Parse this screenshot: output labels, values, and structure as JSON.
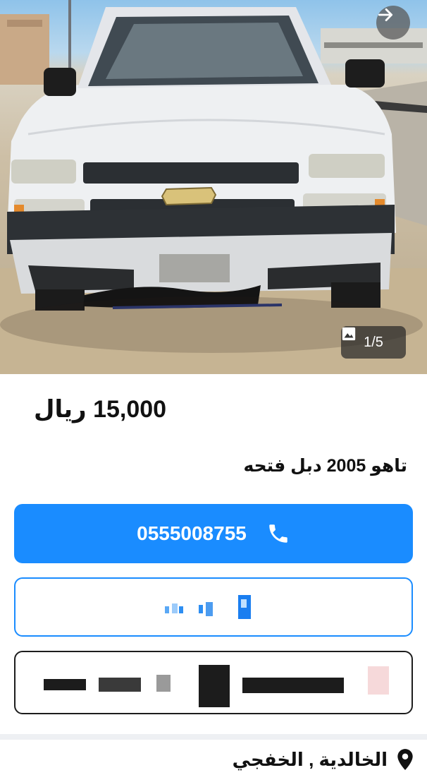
{
  "gallery": {
    "counter_text": "1/5",
    "current": 1,
    "total": 5
  },
  "listing": {
    "price_text": "15,000 ريال",
    "title": "تاهو 2005 دبل فتحه"
  },
  "actions": {
    "phone_number": "0555008755"
  },
  "location": {
    "text": "الخالدية , الخفجي"
  },
  "colors": {
    "accent": "#1a8cff",
    "text": "#111111",
    "divider": "#eef0f3"
  },
  "icons": {
    "next": "arrow-right-icon",
    "gallery": "image-icon",
    "call": "phone-icon",
    "location": "map-pin-icon"
  }
}
